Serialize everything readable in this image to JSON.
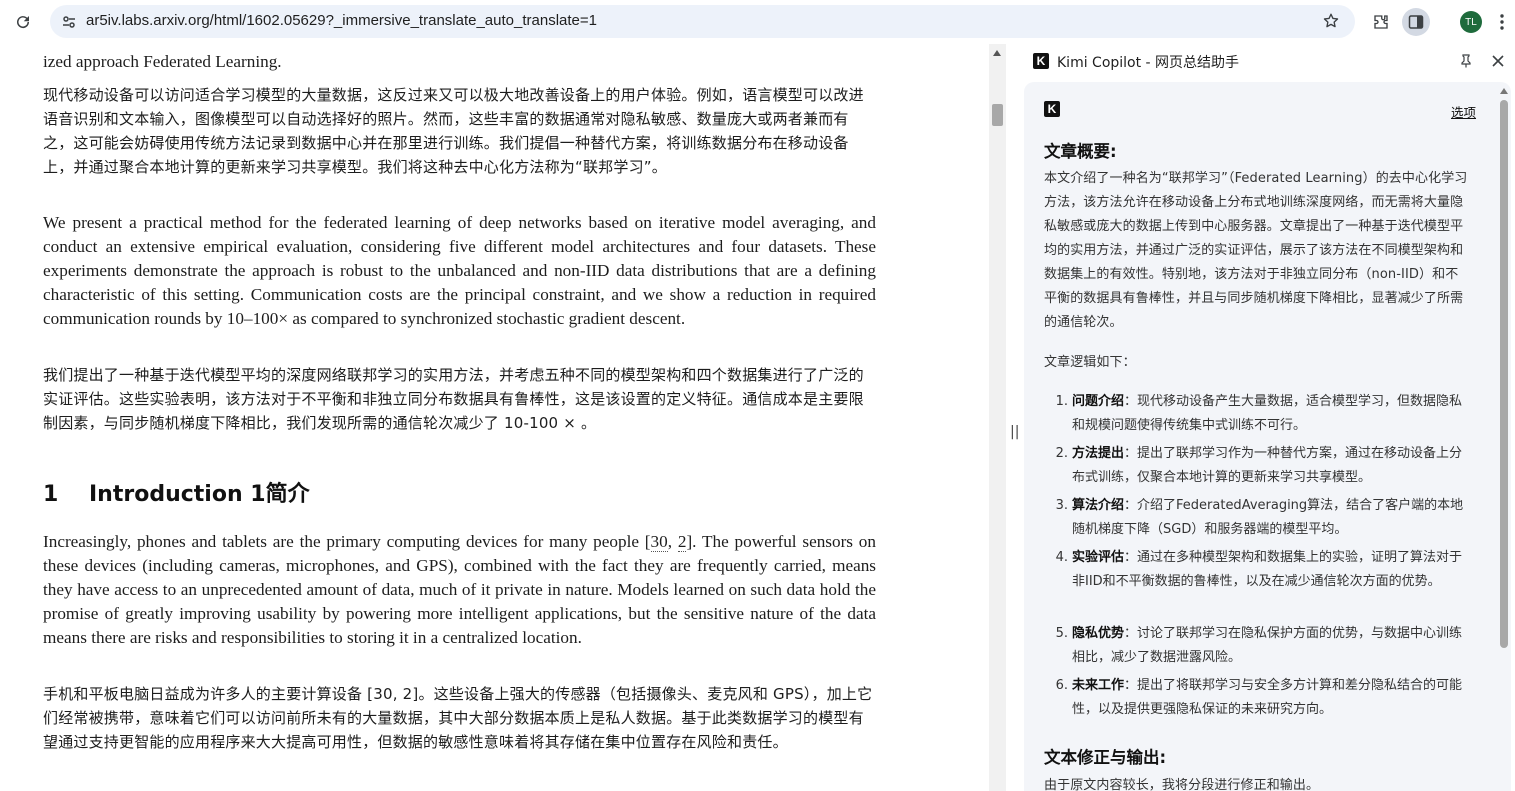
{
  "browser": {
    "url": "ar5iv.labs.arxiv.org/html/1602.05629?_immersive_translate_auto_translate=1",
    "profile_initials": "TL"
  },
  "article": {
    "intro_partial_line": "ized approach Federated Learning.",
    "zh_para1": "现代移动设备可以访问适合学习模型的大量数据，这反过来又可以极大地改善设备上的用户体验。例如，语言模型可以改进语音识别和文本输入，图像模型可以自动选择好的照片。然而，这些丰富的数据通常对隐私敏感、数量庞大或两者兼而有之，这可能会妨碍使用传统方法记录到数据中心并在那里进行训练。我们提倡一种替代方案，将训练数据分布在移动设备上，并通过聚合本地计算的更新来学习共享模型。我们将这种去中心化方法称为“联邦学习”。",
    "en_para2": "We present a practical method for the federated learning of deep networks based on iterative model averaging, and conduct an extensive empirical evaluation, considering five different model architectures and four datasets. These experiments demonstrate the approach is robust to the unbalanced and non-IID data distributions that are a defining characteristic of this setting. Communication costs are the principal constraint, and we show a reduction in required communication rounds by 10–100× as compared to synchronized stochastic gradient descent.",
    "zh_para2": "我们提出了一种基于迭代模型平均的深度网络联邦学习的实用方法，并考虑五种不同的模型架构和四个数据集进行了广泛的实证评估。这些实验表明，该方法对于不平衡和非独立同分布数据具有鲁棒性，这是该设置的定义特征。通信成本是主要限制因素，与同步随机梯度下降相比，我们发现所需的通信轮次减少了 10-100 × 。",
    "section_number": "1",
    "section_title": "Introduction 1简介",
    "en_para3_a": "Increasingly, phones and tablets are the primary computing devices for many people [",
    "cite_30": "30",
    "cite_sep": ", ",
    "cite_2": "2",
    "en_para3_b": "]. The powerful sensors on these devices (including cameras, microphones, and GPS), combined with the fact they are frequently carried, means they have access to an unprecedented amount of data, much of it private in nature. Models learned on such data hold the promise of greatly improving usability by powering more intelligent applications, but the sensitive nature of the data means there are risks and responsibilities to storing it in a centralized location.",
    "zh_para3": "手机和平板电脑日益成为许多人的主要计算设备 [30, 2]。这些设备上强大的传感器（包括摄像头、麦克风和 GPS），加上它们经常被携带，意味着它们可以访问前所未有的大量数据，其中大部分数据本质上是私人数据。基于此类数据学习的模型有望通过支持更智能的应用程序来大大提高可用性，但数据的敏感性意味着将其存储在集中位置存在风险和责任。"
  },
  "panel": {
    "title": "Kimi Copilot - 网页总结助手",
    "options_label": "选项",
    "summary_heading": "文章概要:",
    "summary_text": "本文介绍了一种名为“联邦学习”（Federated Learning）的去中心化学习方法，该方法允许在移动设备上分布式地训练深度网络，而无需将大量隐私敏感或庞大的数据上传到中心服务器。文章提出了一种基于迭代模型平均的实用方法，并通过广泛的实证评估，展示了该方法在不同模型架构和数据集上的有效性。特别地，该方法对于非独立同分布（non-IID）和不平衡的数据具有鲁棒性，并且与同步随机梯度下降相比，显著减少了所需的通信轮次。",
    "logic_intro": "文章逻辑如下：",
    "items": [
      {
        "num": "1.",
        "term": "问题介绍",
        "text": "：现代移动设备产生大量数据，适合模型学习，但数据隐私和规模问题使得传统集中式训练不可行。"
      },
      {
        "num": "2.",
        "term": "方法提出",
        "text": "：提出了联邦学习作为一种替代方案，通过在移动设备上分布式训练，仅聚合本地计算的更新来学习共享模型。"
      },
      {
        "num": "3.",
        "term": "算法介绍",
        "text": "：介绍了FederatedAveraging算法，结合了客户端的本地随机梯度下降（SGD）和服务器端的模型平均。"
      },
      {
        "num": "4.",
        "term": "实验评估",
        "text": "：通过在多种模型架构和数据集上的实验，证明了算法对于非IID和不平衡数据的鲁棒性，以及在减少通信轮次方面的优势。"
      },
      {
        "num": "5.",
        "term": "隐私优势",
        "text": "：讨论了联邦学习在隐私保护方面的优势，与数据中心训练相比，减少了数据泄露风险。"
      },
      {
        "num": "6.",
        "term": "未来工作",
        "text": "：提出了将联邦学习与安全多方计算和差分隐私结合的可能性，以及提供更强隐私保证的未来研究方向。"
      }
    ],
    "output_heading": "文本修正与输出:",
    "output_text": "由于原文内容较长，我将分段进行修正和输出。"
  },
  "colors": {
    "omnibox_bg": "#edf2fa",
    "panel_card_bg": "#f3f5f9",
    "avatar_bg": "#1e6b3c"
  },
  "icons": [
    "reload-icon",
    "site-info-icon",
    "star-icon",
    "extensions-icon",
    "side-panel-icon",
    "more-menu-icon",
    "kimi-logo-icon",
    "pin-icon",
    "close-icon"
  ]
}
